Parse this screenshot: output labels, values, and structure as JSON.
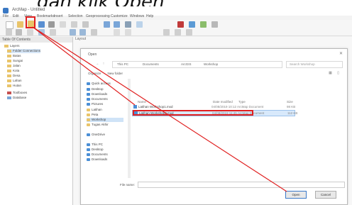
{
  "caption": "dan klik Open",
  "window": {
    "title": "ArcMap - Untitled"
  },
  "menu": [
    "File",
    "Edit",
    "View",
    "Bookmarks",
    "Insert",
    "Selection",
    "Geoprocessing",
    "Customize",
    "Windows",
    "Help"
  ],
  "left_panel": {
    "title": "Table Of Contents",
    "items": [
      "Layers",
      "Folder Connections",
      "Batas",
      "Sungai",
      "Jalan",
      "Kota",
      "Desa",
      "Lahan",
      "Hutan",
      "Toolboxes",
      "Database"
    ]
  },
  "doc_tab": "Layout",
  "dialog": {
    "title": "Open",
    "address": [
      "This PC",
      "Documents",
      "ArcGIS",
      "Workshop"
    ],
    "search_placeholder": "Search Workshop",
    "organize": "Organize",
    "new_folder": "New folder",
    "nav": [
      "Quick access",
      "Desktop",
      "Downloads",
      "Documents",
      "Pictures",
      "Latihan",
      "Peta",
      "Workshop",
      "Tugas Akhir",
      "OneDrive",
      "This PC",
      "Desktop",
      "Documents",
      "Downloads"
    ],
    "columns": {
      "name": "Name",
      "date": "Date modified",
      "type": "Type",
      "size": "Size"
    },
    "files": [
      {
        "name": "Latihan Workshop1.mxd",
        "date": "04/08/2019 10:12",
        "type": "ArcMap Document",
        "size": "98 KB"
      },
      {
        "name": "Latihan Workshop2.mxd",
        "date": "04/08/2019 11:45",
        "type": "ArcMap Document",
        "size": "112 KB"
      }
    ],
    "file_name_label": "File name:",
    "open_button": "Open",
    "cancel_button": "Cancel"
  },
  "colors": {
    "highlight": "#e02020",
    "accent": "#2a6fc9"
  }
}
